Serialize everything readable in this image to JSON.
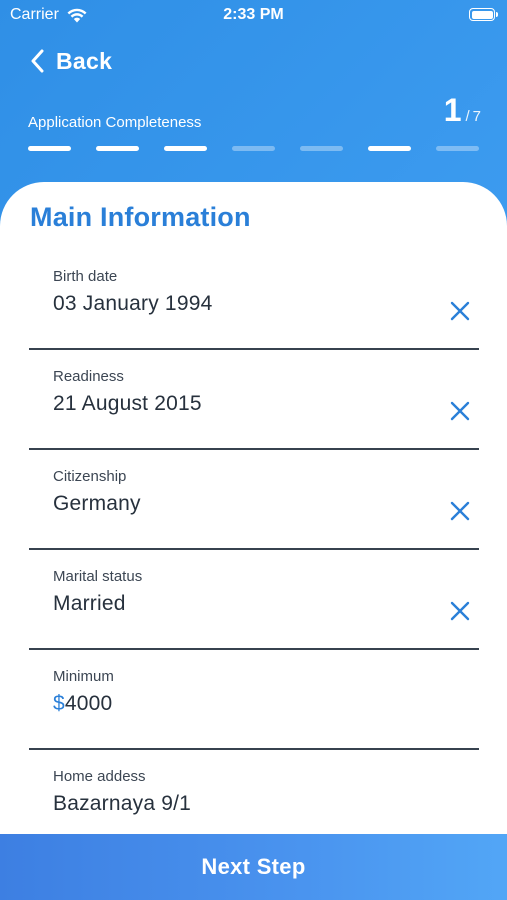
{
  "status_bar": {
    "carrier": "Carrier",
    "time": "2:33 PM",
    "icons": [
      "wifi-icon",
      "battery-icon"
    ]
  },
  "nav": {
    "back_label": "Back",
    "back_icon": "chevron-left-icon"
  },
  "progress": {
    "label": "Application Completeness",
    "current": "1",
    "separator": "/",
    "total": "7",
    "segments": 7
  },
  "form": {
    "title": "Main Information",
    "fields": [
      {
        "label": "Birth date",
        "value": "03 January 1994",
        "clearable": true
      },
      {
        "label": "Readiness",
        "value": "21 August 2015",
        "clearable": true
      },
      {
        "label": "Citizenship",
        "value": "Germany",
        "clearable": true
      },
      {
        "label": "Marital status",
        "value": "Married",
        "clearable": true
      },
      {
        "label": "Minimum",
        "currency": "$",
        "value": "4000",
        "clearable": false
      },
      {
        "label": "Home addess",
        "value": "Bazarnaya 9/1",
        "clearable": false
      }
    ]
  },
  "footer": {
    "next_label": "Next Step"
  },
  "colors": {
    "accent": "#2a7fd8",
    "background_gradient_start": "#2f8fe6",
    "background_gradient_end": "#4aa8f5",
    "divider": "#37424f"
  }
}
